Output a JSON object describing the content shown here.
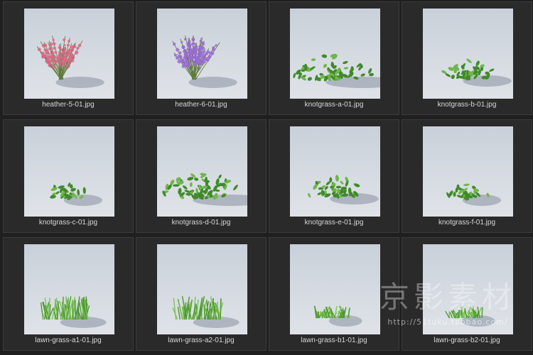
{
  "files": [
    {
      "name": "heather-5-01.jpg",
      "kind": "heather",
      "color": "#d86a86"
    },
    {
      "name": "heather-6-01.jpg",
      "kind": "heather",
      "color": "#9a6ad6"
    },
    {
      "name": "knotgrass-a-01.jpg",
      "kind": "knotgrass-big",
      "color": "#3f8a2a"
    },
    {
      "name": "knotgrass-b-01.jpg",
      "kind": "knotgrass",
      "color": "#3f8a2a"
    },
    {
      "name": "knotgrass-c-01.jpg",
      "kind": "knotgrass-small",
      "color": "#3f8a2a"
    },
    {
      "name": "knotgrass-d-01.jpg",
      "kind": "knotgrass-big",
      "color": "#3f8a2a"
    },
    {
      "name": "knotgrass-e-01.jpg",
      "kind": "knotgrass",
      "color": "#3f8a2a"
    },
    {
      "name": "knotgrass-f-01.jpg",
      "kind": "knotgrass-small",
      "color": "#3f8a2a"
    },
    {
      "name": "lawn-grass-a1-01.jpg",
      "kind": "lawn",
      "color": "#4f9a32"
    },
    {
      "name": "lawn-grass-a2-01.jpg",
      "kind": "lawn",
      "color": "#4f9a32"
    },
    {
      "name": "lawn-grass-b1-01.jpg",
      "kind": "lawn-low",
      "color": "#4f9a32"
    },
    {
      "name": "lawn-grass-b2-01.jpg",
      "kind": "lawn-low",
      "color": "#4f9a32"
    }
  ],
  "watermark": {
    "text": "京影素材",
    "url": "http://51tuku.taobao.com/"
  }
}
